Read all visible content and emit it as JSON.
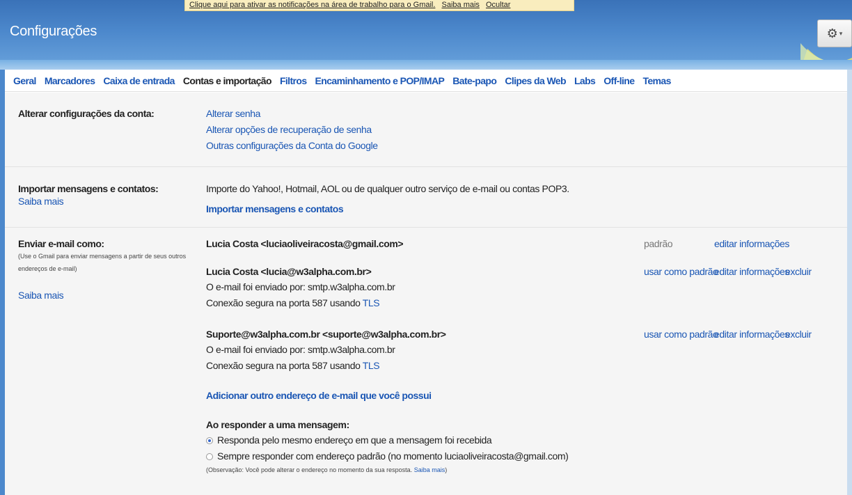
{
  "notice": {
    "text": "Clique aqui para ativar as notificações na área de trabalho para o Gmail.",
    "learn_more": "Saiba mais",
    "hide": "Ocultar"
  },
  "page_title": "Configurações",
  "gear": {
    "icon": "gear-icon",
    "caret": "▾"
  },
  "tabs": [
    {
      "label": "Geral"
    },
    {
      "label": "Marcadores"
    },
    {
      "label": "Caixa de entrada"
    },
    {
      "label": "Contas e importação",
      "active": true
    },
    {
      "label": "Filtros"
    },
    {
      "label": "Encaminhamento e POP/IMAP"
    },
    {
      "label": "Bate-papo"
    },
    {
      "label": "Clipes da Web"
    },
    {
      "label": "Labs"
    },
    {
      "label": "Off-line"
    },
    {
      "label": "Temas"
    }
  ],
  "account": {
    "label": "Alterar configurações da conta:",
    "links": [
      "Alterar senha",
      "Alterar opções de recuperação de senha",
      "Outras configurações da Conta do Google"
    ]
  },
  "import": {
    "label": "Importar mensagens e contatos:",
    "learn_more": "Saiba mais",
    "description": "Importe do Yahoo!, Hotmail, AOL ou de qualquer outro serviço de e-mail ou contas POP3.",
    "action": "Importar mensagens e contatos"
  },
  "send_as": {
    "label": "Enviar e-mail como:",
    "hint_line1": "(Use o Gmail para enviar mensagens a partir de seus outros",
    "hint_line2": "endereços de e-mail)",
    "learn_more": "Saiba mais",
    "entries": [
      {
        "address": "Lucia Costa <luciaoliveiracosta@gmail.com>",
        "status": "padrão",
        "edit": "editar informações"
      },
      {
        "address": "Lucia Costa <lucia@w3alpha.com.br>",
        "sent_via": "O e-mail foi enviado por: smtp.w3alpha.com.br",
        "secure_prefix": "Conexão segura na porta 587 usando",
        "secure_link": "TLS",
        "make_default": "usar como padrão",
        "edit": "editar informações",
        "delete": "excluir"
      },
      {
        "address": "Suporte@w3alpha.com.br <suporte@w3alpha.com.br>",
        "sent_via": "O e-mail foi enviado por: smtp.w3alpha.com.br",
        "secure_prefix": "Conexão segura na porta 587 usando",
        "secure_link": "TLS",
        "make_default": "usar como padrão",
        "edit": "editar informações",
        "delete": "excluir"
      }
    ],
    "add_address": "Adicionar outro endereço de e-mail que você possui",
    "reply_heading": "Ao responder a uma mensagem:",
    "reply_options": [
      {
        "label": "Responda pelo mesmo endereço em que a mensagem foi recebida",
        "selected": true
      },
      {
        "label": "Sempre responder com endereço padrão (no momento luciaoliveiracosta@gmail.com)",
        "selected": false
      }
    ],
    "note_prefix": "(Observação: Você pode alterar o endereço no momento da sua resposta.",
    "note_link": "Saiba mais",
    "note_suffix": ")"
  },
  "colors": {
    "header": "#4c88cc",
    "link": "#1a56b4",
    "content_bg": "#f5f5f5",
    "notice_bg": "#f9edbe"
  }
}
